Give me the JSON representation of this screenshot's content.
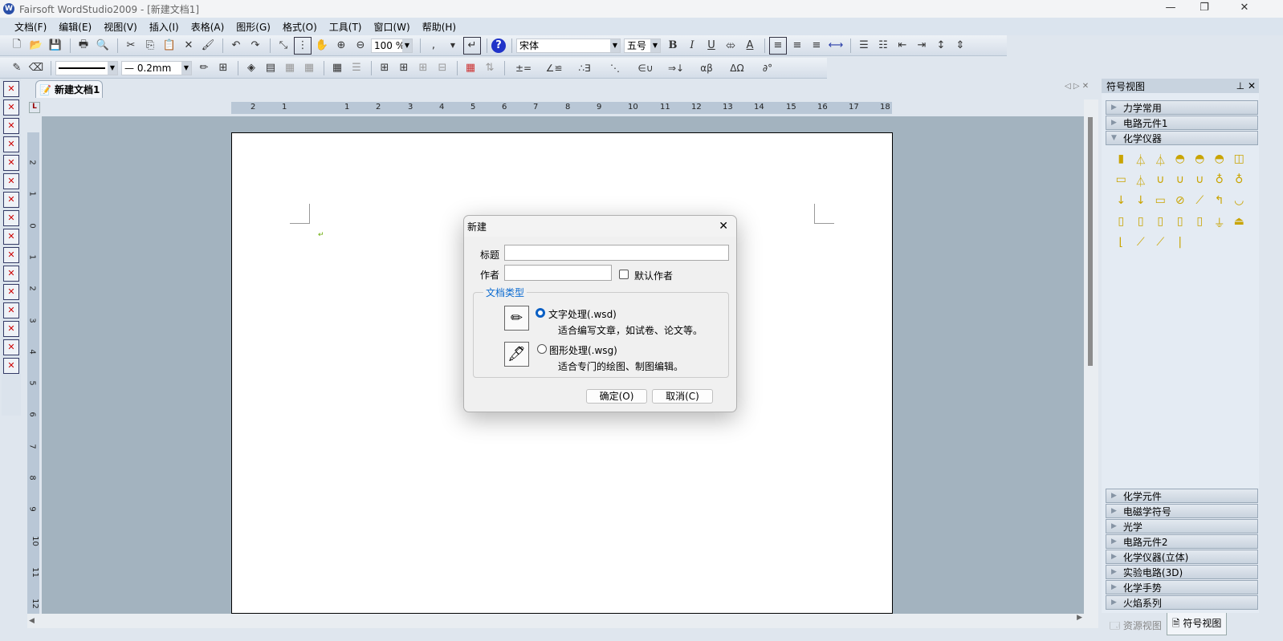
{
  "window": {
    "title": "Fairsoft WordStudio2009 - [新建文档1]",
    "logo": "W"
  },
  "menu": [
    "文档(F)",
    "编辑(E)",
    "视图(V)",
    "插入(I)",
    "表格(A)",
    "图形(G)",
    "格式(O)",
    "工具(T)",
    "窗口(W)",
    "帮助(H)"
  ],
  "toolbar1": {
    "zoom": "100 %",
    "comma": ",",
    "font": "宋体",
    "size": "五号",
    "bold": "B",
    "italic": "I",
    "underline": "U",
    "fontcolor": "A"
  },
  "toolbar2": {
    "line_width": "— 0.2mm",
    "symbols": [
      "±=",
      "∠≌",
      "∴∃",
      "⋱",
      "∈∪",
      "⇒↓",
      "αβ",
      "ΔΩ",
      "∂°"
    ]
  },
  "doc_tab": "新建文档1",
  "ruler": {
    "h": [
      "2",
      "1",
      "1",
      "2",
      "3",
      "4",
      "5",
      "6",
      "7",
      "8",
      "9",
      "10",
      "11",
      "12",
      "13",
      "14",
      "15",
      "16",
      "17",
      "18"
    ],
    "v": [
      "2",
      "1",
      "0",
      "1",
      "2",
      "3",
      "4",
      "5",
      "6",
      "7",
      "8",
      "9",
      "10",
      "11",
      "12"
    ]
  },
  "panel": {
    "title": "符号视图",
    "top_cats": [
      "力学常用",
      "电路元件1",
      "化学仪器"
    ],
    "bottom_cats": [
      "化学元件",
      "电磁学符号",
      "光学",
      "电路元件2",
      "化学仪器(立体)",
      "实验电路(3D)",
      "化学手势",
      "火焰系列"
    ],
    "tabs": [
      "资源视图",
      "符号视图"
    ]
  },
  "dialog": {
    "title": "新建",
    "title_label": "标题",
    "title_value": "",
    "author_label": "作者",
    "author_value": "",
    "default_author": "默认作者",
    "group": "文档类型",
    "opt1": "文字处理(.wsd)",
    "opt1_desc": "适合编写文章，如试卷、论文等。",
    "opt2": "图形处理(.wsg)",
    "opt2_desc": "适合专门的绘图、制图编辑。",
    "selected": "wsd",
    "ok": "确定(O)",
    "cancel": "取消(C)"
  },
  "colors": {
    "accent": "#0a5fc4",
    "canvas": "#a3b3bf"
  }
}
